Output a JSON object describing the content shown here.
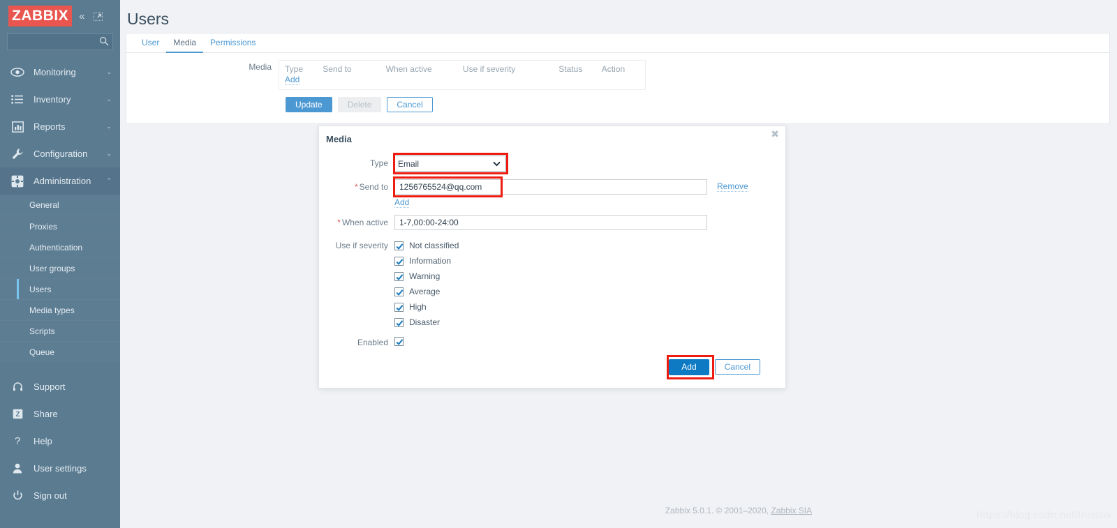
{
  "brand": {
    "logo_text": "ZABBIX",
    "logo_bg": "#e8564f"
  },
  "sidebar": {
    "collapse_icon": "chevron-double-left-icon",
    "expand_icon": "expand-arrow-icon",
    "search": {
      "value": "",
      "placeholder": ""
    },
    "nav": [
      {
        "label": "Monitoring",
        "icon": "eye-icon",
        "chevron": "⌄"
      },
      {
        "label": "Inventory",
        "icon": "list-icon",
        "chevron": "⌄"
      },
      {
        "label": "Reports",
        "icon": "bar-chart-icon",
        "chevron": "⌄"
      },
      {
        "label": "Configuration",
        "icon": "wrench-icon",
        "chevron": "⌄"
      },
      {
        "label": "Administration",
        "icon": "gear-icon",
        "chevron": "⌃"
      }
    ],
    "submenu": [
      {
        "label": "General",
        "active": false
      },
      {
        "label": "Proxies",
        "active": false
      },
      {
        "label": "Authentication",
        "active": false
      },
      {
        "label": "User groups",
        "active": false
      },
      {
        "label": "Users",
        "active": true
      },
      {
        "label": "Media types",
        "active": false
      },
      {
        "label": "Scripts",
        "active": false
      },
      {
        "label": "Queue",
        "active": false
      }
    ],
    "footer_nav": [
      {
        "label": "Support",
        "icon": "headset-icon"
      },
      {
        "label": "Share",
        "icon": "zabbix-share-icon"
      },
      {
        "label": "Help",
        "icon": "question-mark-icon"
      },
      {
        "label": "User settings",
        "icon": "person-icon"
      },
      {
        "label": "Sign out",
        "icon": "power-icon"
      }
    ]
  },
  "page": {
    "title": "Users",
    "tabs": [
      {
        "label": "User",
        "active": false
      },
      {
        "label": "Media",
        "active": true
      },
      {
        "label": "Permissions",
        "active": false
      }
    ],
    "form": {
      "media_label": "Media",
      "table_headers": [
        "Type",
        "Send to",
        "When active",
        "Use if severity",
        "Status",
        "Action"
      ],
      "add_link": "Add",
      "buttons": {
        "update": "Update",
        "delete": "Delete",
        "cancel": "Cancel"
      }
    }
  },
  "modal": {
    "title": "Media",
    "close_icon": "close-icon",
    "fields": {
      "type_label": "Type",
      "type_value": "Email",
      "type_options": [
        "Email"
      ],
      "sendto_label": "Send to",
      "sendto_required": "*",
      "sendto_value": "1256765524@qq.com",
      "sendto_remove_link": "Remove",
      "sendto_add_link": "Add",
      "whenactive_label": "When active",
      "whenactive_required": "*",
      "whenactive_value": "1-7,00:00-24:00",
      "severity_label": "Use if severity",
      "severities": [
        {
          "label": "Not classified",
          "checked": true
        },
        {
          "label": "Information",
          "checked": true
        },
        {
          "label": "Warning",
          "checked": true
        },
        {
          "label": "Average",
          "checked": true
        },
        {
          "label": "High",
          "checked": true
        },
        {
          "label": "Disaster",
          "checked": true
        }
      ],
      "enabled_label": "Enabled",
      "enabled_checked": true
    },
    "footer": {
      "add_label": "Add",
      "cancel_label": "Cancel"
    },
    "highlight_color": "#ee1c10"
  },
  "footer": {
    "text": "Zabbix 5.0.1. © 2001–2020, ",
    "link": "Zabbix SIA"
  },
  "watermark": "https://blog.csdn.net/Insistw"
}
